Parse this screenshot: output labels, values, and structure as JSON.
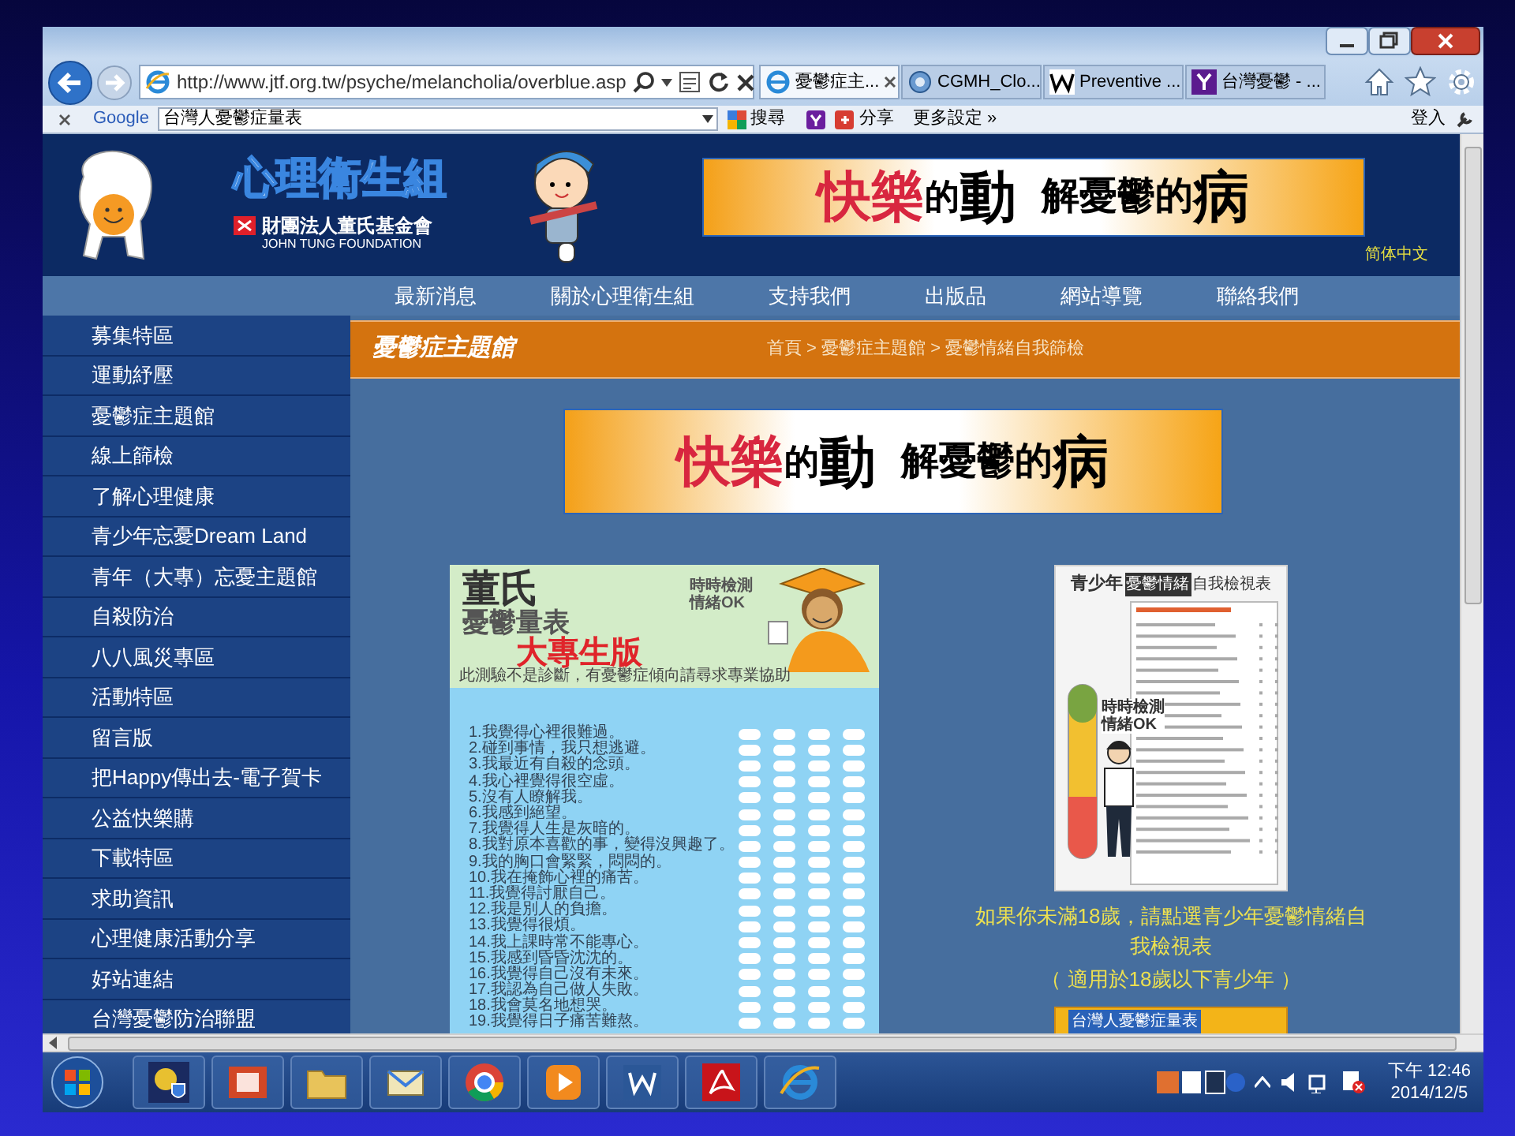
{
  "browser": {
    "address": "http://www.jtf.org.tw/psyche/melancholia/overblue.asp",
    "tabs": [
      {
        "label": "憂鬱症主...",
        "kind": "ie",
        "selected": true
      },
      {
        "label": "CGMH_Clo...",
        "kind": "globe",
        "selected": false
      },
      {
        "label": "Preventive ...",
        "kind": "wiki",
        "selected": false
      },
      {
        "label": "台灣憂鬱 - ...",
        "kind": "yahoo",
        "selected": false
      }
    ],
    "toolbar": {
      "brand": "Google",
      "query": "台灣人憂鬱症量表",
      "search": "搜尋",
      "share": "分享",
      "more": "更多設定 »",
      "sign_in": "登入"
    }
  },
  "site": {
    "logo_title": "心理衛生組",
    "org_name": "財團法人董氏基金會",
    "org_name_en": "JOHN TUNG FOUNDATION",
    "language_link": "简体中文",
    "header_banner": [
      {
        "text": "快樂",
        "kind": "accent"
      },
      {
        "text": "的",
        "kind": "small"
      },
      {
        "text": "動",
        "kind": "big"
      },
      {
        "text": "解憂鬱的",
        "kind": "plain"
      },
      {
        "text": "病",
        "kind": "big"
      }
    ],
    "nav": [
      "最新消息",
      "關於心理衛生組",
      "支持我們",
      "出版品",
      "網站導覽",
      "聯絡我們"
    ],
    "sidebar": [
      "募集特區",
      "運動紓壓",
      "憂鬱症主題館",
      "線上篩檢",
      "了解心理健康",
      "青少年忘憂Dream Land",
      "青年（大專）忘憂主題館",
      "自殺防治",
      "八八風災專區",
      "活動特區",
      "留言版",
      "把Happy傳出去-電子賀卡",
      "公益快樂購",
      "下載特區",
      "求助資訊",
      "心理健康活動分享",
      "好站連結",
      "台灣憂鬱防治聯盟"
    ],
    "section_title": "憂鬱症主題館",
    "breadcrumb": "首頁 > 憂鬱症主題館 > 憂鬱情緒自我篩檢",
    "content_banner": [
      {
        "text": "快樂",
        "kind": "accent"
      },
      {
        "text": "的",
        "kind": "small"
      },
      {
        "text": "動",
        "kind": "big"
      },
      {
        "text": "解憂鬱的",
        "kind": "plain"
      },
      {
        "text": "病",
        "kind": "big"
      }
    ],
    "scale_card": {
      "title": "董氏",
      "subtitle": "憂鬱量表",
      "edition": "大專生版",
      "slogan": [
        "時時檢測",
        "情緒OK"
      ],
      "note": "此測驗不是診斷，有憂鬱症傾向請尋求專業協助",
      "items": [
        "1.我覺得心裡很難過。",
        "2.碰到事情，我只想逃避。",
        "3.我最近有自殺的念頭。",
        "4.我心裡覺得很空虛。",
        "5.沒有人瞭解我。",
        "6.我感到絕望。",
        "7.我覺得人生是灰暗的。",
        "8.我對原本喜歡的事，變得沒興趣了。",
        "9.我的胸口會緊緊，悶悶的。",
        "10.我在掩飾心裡的痛苦。",
        "11.我覺得討厭自己。",
        "12.我是別人的負擔。",
        "13.我覺得很煩。",
        "14.我上課時常不能專心。",
        "15.我感到昏昏沈沈的。",
        "16.我覺得自己沒有未來。",
        "17.我認為自己做人失敗。",
        "18.我會莫名地想哭。",
        "19.我覺得日子痛苦難熬。"
      ]
    },
    "teen_card": {
      "title": "青少年",
      "tag": "憂鬱情緒",
      "title_end": "自我檢視表",
      "slogan": [
        "時時檢測",
        "情緒OK"
      ]
    },
    "teen_caption": "如果你未滿18歲，請點選青少年憂鬱情緒自我檢視表",
    "teen_note": "（ 適用於18歲以下青少年 ）",
    "bottom_banner": "台灣人憂鬱症量表"
  },
  "taskbar": {
    "apps": [
      {
        "kind": "security"
      },
      {
        "kind": "slides"
      },
      {
        "kind": "folder"
      },
      {
        "kind": "mail"
      },
      {
        "kind": "chrome"
      },
      {
        "kind": "media"
      },
      {
        "kind": "word"
      },
      {
        "kind": "pdf"
      },
      {
        "kind": "ie"
      }
    ],
    "time": "下午 12:46",
    "date": "2014/12/5"
  }
}
